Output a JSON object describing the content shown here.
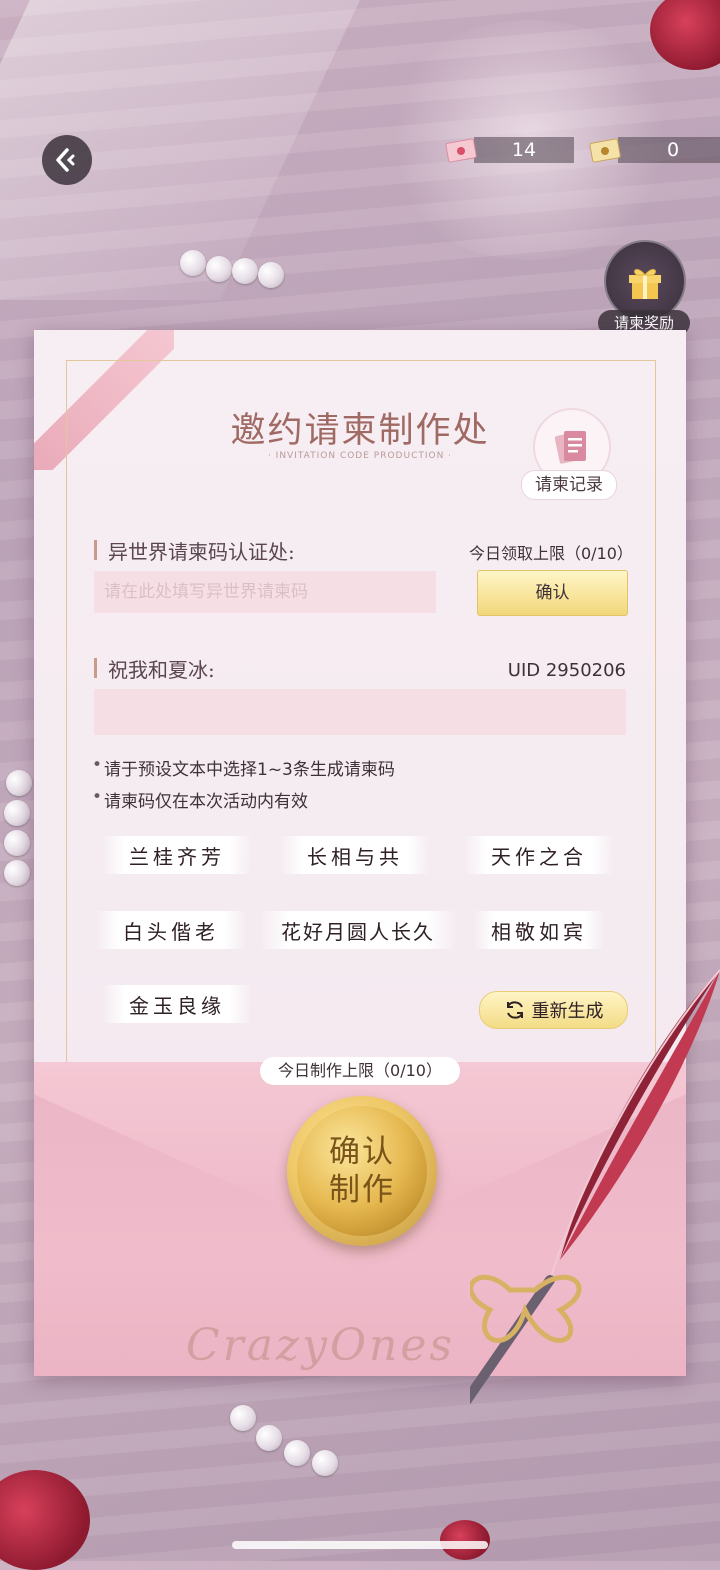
{
  "top_bar": {
    "envelope_count": "14",
    "letter_count": "0",
    "gift_label": "请柬奖励"
  },
  "card": {
    "title": "邀约请柬制作处",
    "subtitle": "· INVITATION CODE PRODUCTION ·",
    "record_label": "请柬记录",
    "code_section_label": "异世界请柬码认证处:",
    "claim_limit": "今日领取上限（0/10）",
    "code_placeholder": "请在此处填写异世界请柬码",
    "confirm_label": "确认",
    "message_section_label": "祝我和夏冰:",
    "uid": "UID  2950206",
    "notes": [
      "请于预设文本中选择1~3条生成请柬码",
      "请柬码仅在本次活动内有效"
    ],
    "phrases": [
      "兰桂齐芳",
      "长相与共",
      "天作之合",
      "白头偕老",
      "花好月圆人长久",
      "相敬如宾",
      "金玉良缘"
    ],
    "regenerate_label": "重新生成",
    "daily_make_limit": "今日制作上限（0/10）",
    "seal_line1": "确认",
    "seal_line2": "制作",
    "script_text": "CrazyOnes"
  },
  "colors": {
    "title": "#a06a64",
    "button_gold": "#f2d77a",
    "envelope_pink": "#eeb7c7"
  }
}
